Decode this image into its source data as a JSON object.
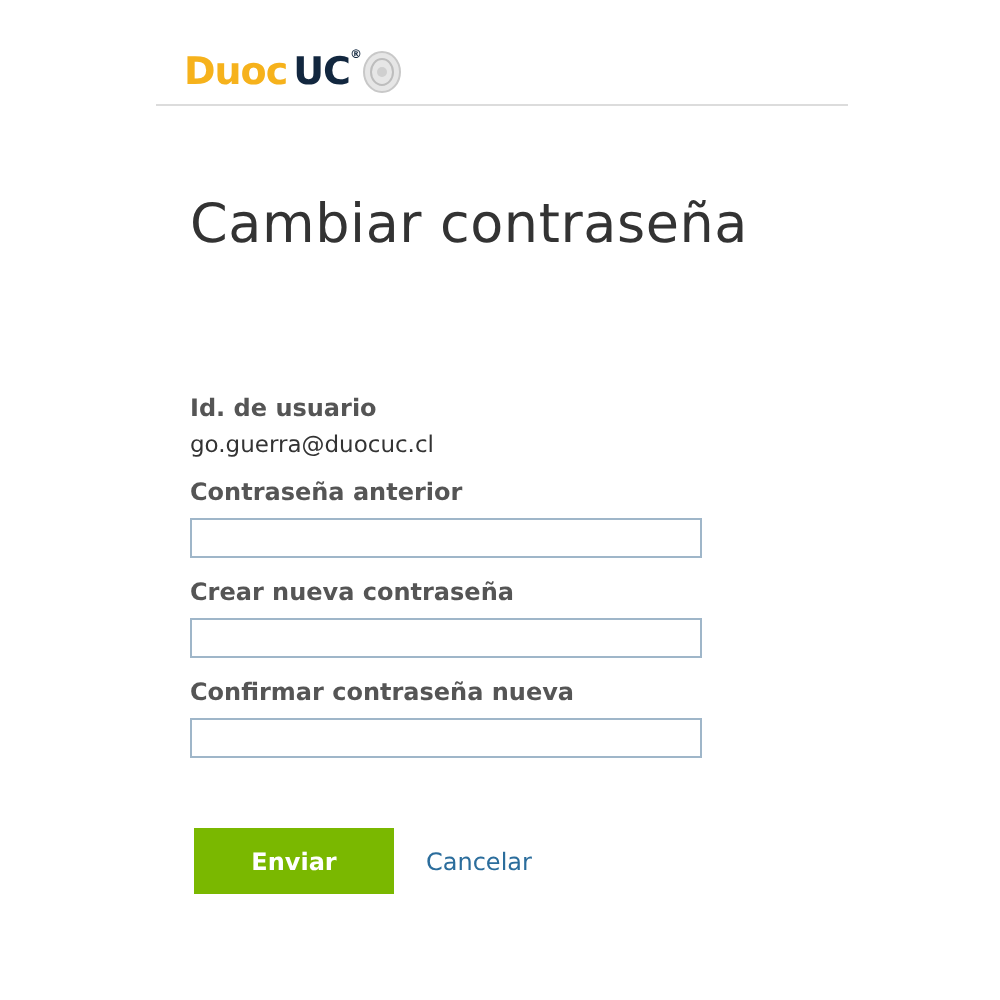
{
  "logo": {
    "brand_first": "Duoc",
    "brand_second": "UC",
    "mark": "®"
  },
  "title": "Cambiar contraseña",
  "user_id": {
    "label": "Id. de usuario",
    "value": "go.guerra@duocuc.cl"
  },
  "fields": [
    {
      "label": "Contraseña anterior"
    },
    {
      "label": "Crear nueva contraseña"
    },
    {
      "label": "Confirmar contraseña nueva"
    }
  ],
  "buttons": {
    "submit": "Enviar",
    "cancel": "Cancelar"
  }
}
